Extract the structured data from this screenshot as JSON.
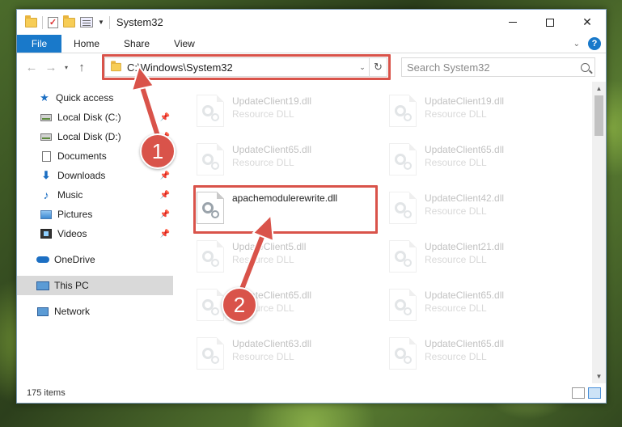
{
  "window": {
    "title": "System32",
    "minimize": "–",
    "maximize": "□",
    "close": "✕"
  },
  "ribbon": {
    "tabs": [
      "File",
      "Home",
      "Share",
      "View"
    ],
    "help": "?"
  },
  "nav": {
    "back": "←",
    "forward": "→",
    "recent": "▾",
    "up": "↑",
    "address": "C:\\Windows\\System32",
    "refresh": "↻",
    "search_placeholder": "Search System32"
  },
  "sidebar": {
    "quick_access": "Quick access",
    "items": [
      {
        "label": "Local Disk (C:)",
        "icon": "hard-drive-icon"
      },
      {
        "label": "Local Disk (D:)",
        "icon": "hard-drive-icon"
      },
      {
        "label": "Documents",
        "icon": "documents-icon"
      },
      {
        "label": "Downloads",
        "icon": "downloads-icon"
      },
      {
        "label": "Music",
        "icon": "music-icon"
      },
      {
        "label": "Pictures",
        "icon": "pictures-icon"
      },
      {
        "label": "Videos",
        "icon": "videos-icon"
      }
    ],
    "onedrive": "OneDrive",
    "this_pc": "This PC",
    "network": "Network"
  },
  "files": [
    {
      "name": "UpdateClient19.dll",
      "type": "Resource DLL"
    },
    {
      "name": "UpdateClient19.dll",
      "type": "Resource DLL"
    },
    {
      "name": "UpdateClient65.dll",
      "type": "Resource DLL"
    },
    {
      "name": "UpdateClient65.dll",
      "type": "Resource DLL"
    },
    {
      "name": "apachemodulerewrite.dll",
      "type": ""
    },
    {
      "name": "UpdateClient42.dll",
      "type": "Resource DLL"
    },
    {
      "name": "UpdateClient5.dll",
      "type": "Resource DLL"
    },
    {
      "name": "UpdateClient21.dll",
      "type": "Resource DLL"
    },
    {
      "name": "UpdateClient65.dll",
      "type": "Resource DLL"
    },
    {
      "name": "UpdateClient65.dll",
      "type": "Resource DLL"
    },
    {
      "name": "UpdateClient63.dll",
      "type": "Resource DLL"
    },
    {
      "name": "UpdateClient65.dll",
      "type": "Resource DLL"
    }
  ],
  "status": {
    "item_count": "175 items"
  },
  "callouts": {
    "one": "1",
    "two": "2"
  },
  "colors": {
    "accent": "#1979ca",
    "highlight": "#d9534a"
  }
}
